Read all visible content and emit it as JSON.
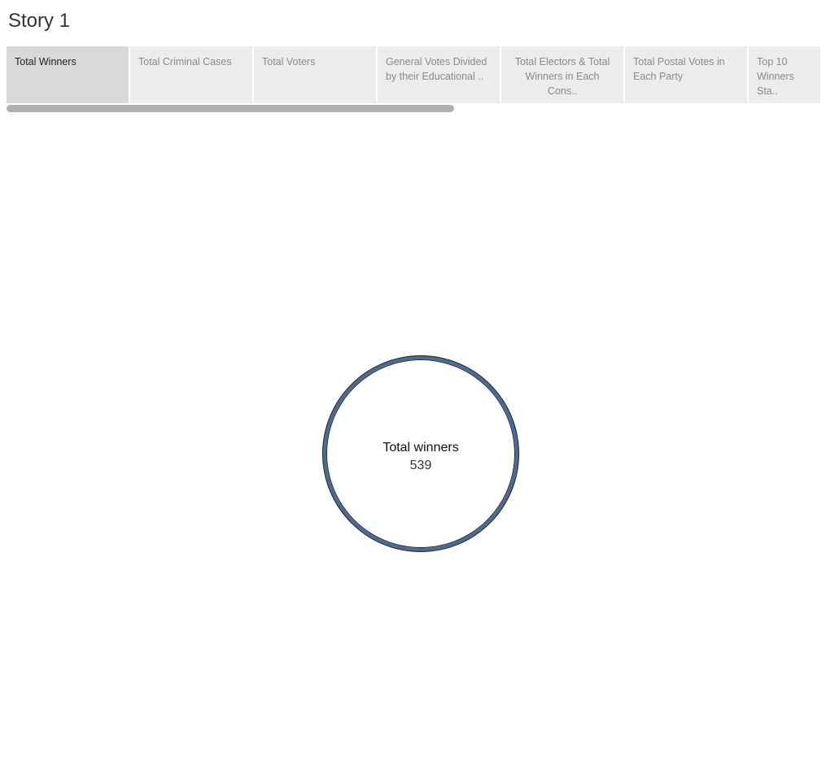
{
  "story_title": "Story 1",
  "tabs": [
    {
      "label": "Total Winners"
    },
    {
      "label": "Total Criminal Cases"
    },
    {
      "label": "Total Voters"
    },
    {
      "label": "General Votes Divided by their Educational .."
    },
    {
      "label": "Total Electors & Total Winners in Each Cons.."
    },
    {
      "label": "Total Postal Votes in Each Party"
    },
    {
      "label": "Top 10 Winners Sta.."
    }
  ],
  "kpi": {
    "label": "Total winners",
    "value": "539"
  },
  "colors": {
    "ring": "#4a6c94",
    "active_tab": "#d9d9d9",
    "tab": "#ececec"
  }
}
